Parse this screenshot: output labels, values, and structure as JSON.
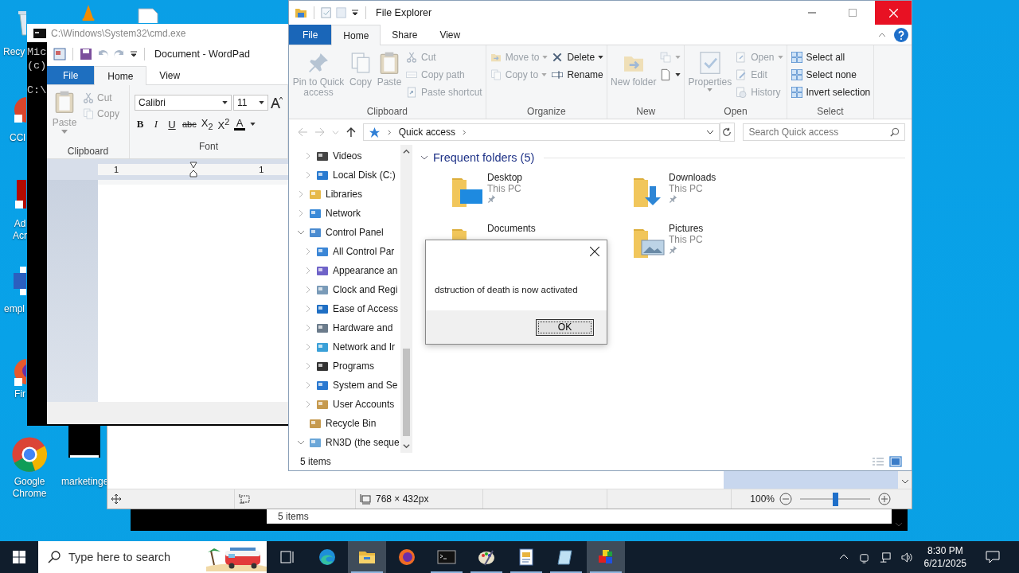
{
  "desktop_icons": [
    {
      "lines": [
        "Recy"
      ]
    },
    {
      "lines": [
        "CCl"
      ]
    },
    {
      "lines": [
        "Ad",
        "Acr"
      ]
    },
    {
      "lines": [
        "empl"
      ]
    },
    {
      "lines": [
        "Fir"
      ]
    },
    {
      "lines": [
        "Google",
        "Chrome"
      ]
    },
    {
      "lines": [
        "marketinge"
      ]
    }
  ],
  "cmd": {
    "title": "C:\\Windows\\System32\\cmd.exe",
    "lines": [
      "Mic",
      "(c)",
      "C:\\"
    ]
  },
  "wordpad": {
    "title": "Document - WordPad",
    "tabs": [
      {
        "label": "File",
        "kind": "file",
        "selected": false
      },
      {
        "label": "Home",
        "kind": "tab",
        "selected": true
      },
      {
        "label": "View",
        "kind": "tab",
        "selected": false
      }
    ],
    "clipboard": {
      "label": "Clipboard",
      "items": [
        {
          "label": "Paste",
          "disabled": true
        },
        {
          "label": "Cut",
          "disabled": true
        },
        {
          "label": "Copy",
          "disabled": true
        }
      ]
    },
    "font": {
      "label": "Font",
      "family": "Calibri",
      "size": "11",
      "buttons": [
        "B",
        "I",
        "U",
        "abc",
        "X$_{2}$",
        "X$^{2}$",
        "A"
      ]
    },
    "ruler": [
      "1",
      "1"
    ]
  },
  "paint": {
    "dimensions": "768 × 432px",
    "zoom": "100%",
    "zoom_slider": {
      "level": 0.5
    }
  },
  "background_window": {
    "status": "5 items"
  },
  "explorer": {
    "title": "File Explorer",
    "tabs": [
      {
        "label": "File",
        "kind": "file",
        "selected": false
      },
      {
        "label": "Home",
        "kind": "tab",
        "selected": true
      },
      {
        "label": "Share",
        "kind": "tab",
        "selected": false
      },
      {
        "label": "View",
        "kind": "tab",
        "selected": false
      }
    ],
    "ribbon": [
      {
        "label": "Clipboard",
        "columns": [
          [
            {
              "label": "Pin to Quick access",
              "disabled": true
            }
          ],
          [
            {
              "label": "Copy",
              "disabled": true
            }
          ],
          [
            {
              "label": "Paste",
              "disabled": true
            }
          ],
          [
            {
              "label": "Cut",
              "disabled": true
            },
            {
              "label": "Copy path",
              "disabled": true
            },
            {
              "label": "Paste shortcut",
              "disabled": true
            }
          ]
        ]
      },
      {
        "label": "Organize",
        "columns": [
          [
            {
              "label": "Move to",
              "disabled": true,
              "menu": true
            },
            {
              "label": "Copy to",
              "disabled": true,
              "menu": true
            }
          ],
          [
            {
              "label": "Delete",
              "disabled": false,
              "menu": true
            },
            {
              "label": "Rename",
              "disabled": false
            }
          ]
        ]
      },
      {
        "label": "New",
        "columns": [
          [
            {
              "label": "New folder",
              "disabled": true
            }
          ],
          [
            {
              "disabled": true,
              "menu": true
            },
            {
              "disabled": false,
              "menu": true
            }
          ]
        ]
      },
      {
        "label": "Open",
        "columns": [
          [
            {
              "label": "Properties",
              "disabled": true,
              "menu": true
            }
          ],
          [
            {
              "label": "Open",
              "disabled": true,
              "menu": true
            },
            {
              "label": "Edit",
              "disabled": true
            },
            {
              "label": "History",
              "disabled": true
            }
          ]
        ]
      },
      {
        "label": "Select",
        "columns": [
          [
            {
              "label": "Select all",
              "disabled": false
            },
            {
              "label": "Select none",
              "disabled": false
            },
            {
              "label": "Invert selection",
              "disabled": false
            }
          ]
        ]
      }
    ],
    "address": "Quick access",
    "search": {
      "placeholder": "Search Quick access"
    },
    "nav_tree": {
      "continued": [
        {
          "label": "Videos",
          "expanded": false
        },
        {
          "label": "Local Disk (C:)",
          "expanded": false
        }
      ],
      "items": [
        {
          "label": "Libraries",
          "expanded": false
        },
        {
          "label": "Network",
          "expanded": false
        },
        {
          "label": "Control Panel",
          "expanded": true,
          "children": [
            {
              "label": "All Control Par",
              "expanded": false
            },
            {
              "label": "Appearance an",
              "expanded": false
            },
            {
              "label": "Clock and Regi",
              "expanded": false
            },
            {
              "label": "Ease of Access",
              "expanded": false
            },
            {
              "label": "Hardware and",
              "expanded": false
            },
            {
              "label": "Network and Ir",
              "expanded": false
            },
            {
              "label": "Programs",
              "expanded": false
            },
            {
              "label": "System and Se",
              "expanded": false
            },
            {
              "label": "User Accounts",
              "expanded": false
            }
          ]
        },
        {
          "label": "Recycle Bin"
        },
        {
          "label": "RN3D (the seque",
          "expanded": true
        }
      ]
    },
    "section": "Frequent folders (5)",
    "folders": [
      {
        "name": "Desktop",
        "location": "This PC",
        "pinned": true
      },
      {
        "name": "Downloads",
        "location": "This PC",
        "pinned": true
      },
      {
        "name": "Documents"
      },
      {
        "name": "Pictures",
        "location": "This PC",
        "pinned": true
      }
    ],
    "status": "5 items"
  },
  "dialog": {
    "message": "dstruction of death is now activated",
    "button": "OK"
  },
  "taskbar": {
    "search": {
      "placeholder": "Type here to search"
    },
    "apps": [
      {
        "selected": false,
        "running": false
      },
      {
        "selected": false,
        "running": false
      },
      {
        "selected": true,
        "running": true
      },
      {
        "selected": false,
        "running": false
      },
      {
        "selected": false,
        "running": true
      },
      {
        "selected": false,
        "running": true
      },
      {
        "selected": false,
        "running": true
      },
      {
        "selected": false,
        "running": true
      },
      {
        "selected": true,
        "running": true
      }
    ],
    "time": "8:30 PM",
    "date": "6/21/2025"
  }
}
